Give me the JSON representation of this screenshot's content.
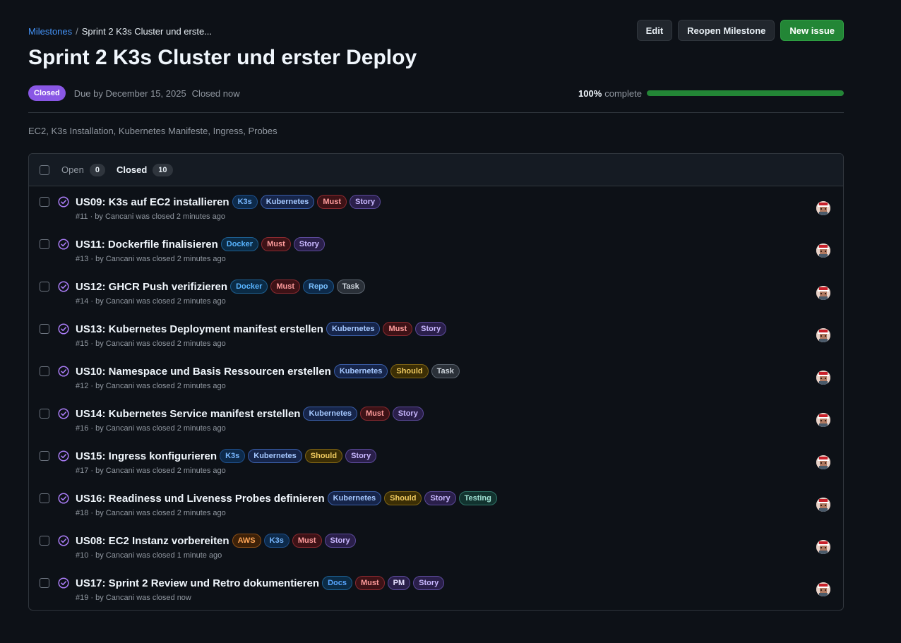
{
  "breadcrumb": {
    "root": "Milestones",
    "separator": "/",
    "current": "Sprint 2 K3s Cluster und erste..."
  },
  "actions": {
    "edit": "Edit",
    "reopen": "Reopen Milestone",
    "new_issue": "New issue"
  },
  "title": "Sprint 2 K3s Cluster und erster Deploy",
  "meta": {
    "state": "Closed",
    "due": "Due by December 15, 2025",
    "closed": "Closed now",
    "percent": "100%",
    "complete_label": "complete",
    "progress_fraction": 1.0
  },
  "description": "EC2, K3s Installation, Kubernetes Manifeste, Ingress, Probes",
  "tabs": {
    "open_label": "Open",
    "open_count": "0",
    "closed_label": "Closed",
    "closed_count": "10"
  },
  "label_colors": {
    "K3s": {
      "fg": "#79b8ff",
      "bg": "#0d2a4a",
      "border": "#1f4f8a"
    },
    "Kubernetes": {
      "fg": "#a5c8ff",
      "bg": "#16254a",
      "border": "#3a5ea8"
    },
    "Must": {
      "fg": "#ff9c9c",
      "bg": "#3d1216",
      "border": "#8a2a30"
    },
    "Story": {
      "fg": "#c9b8ff",
      "bg": "#2a1f4a",
      "border": "#5b4a9a"
    },
    "Docker": {
      "fg": "#58b4ff",
      "bg": "#0b2b45",
      "border": "#1d5e8f"
    },
    "Repo": {
      "fg": "#79c0ff",
      "bg": "#0d2a4a",
      "border": "#1f5a8f"
    },
    "Task": {
      "fg": "#d0d7de",
      "bg": "#2a3038",
      "border": "#5a636e"
    },
    "Should": {
      "fg": "#f2cc60",
      "bg": "#3b2e05",
      "border": "#806515"
    },
    "Testing": {
      "fg": "#9fe0d2",
      "bg": "#12332f",
      "border": "#2f7468"
    },
    "AWS": {
      "fg": "#ffa657",
      "bg": "#3d2108",
      "border": "#8a4e16"
    },
    "Docs": {
      "fg": "#58a6ff",
      "bg": "#0b2b45",
      "border": "#1d5e8f"
    },
    "PM": {
      "fg": "#e6e0ff",
      "bg": "#2a1f4a",
      "border": "#5b4a9a"
    }
  },
  "issues": [
    {
      "title": "US09: K3s auf EC2 installieren",
      "labels": [
        "K3s",
        "Kubernetes",
        "Must",
        "Story"
      ],
      "sub": "#11 · by Cancani was closed 2 minutes ago"
    },
    {
      "title": "US11: Dockerfile finalisieren",
      "labels": [
        "Docker",
        "Must",
        "Story"
      ],
      "sub": "#13 · by Cancani was closed 2 minutes ago"
    },
    {
      "title": "US12: GHCR Push verifizieren",
      "labels": [
        "Docker",
        "Must",
        "Repo",
        "Task"
      ],
      "sub": "#14 · by Cancani was closed 2 minutes ago"
    },
    {
      "title": "US13: Kubernetes Deployment manifest erstellen",
      "labels": [
        "Kubernetes",
        "Must",
        "Story"
      ],
      "sub": "#15 · by Cancani was closed 2 minutes ago"
    },
    {
      "title": "US10: Namespace und Basis Ressourcen erstellen",
      "labels": [
        "Kubernetes",
        "Should",
        "Task"
      ],
      "sub": "#12 · by Cancani was closed 2 minutes ago"
    },
    {
      "title": "US14: Kubernetes Service manifest erstellen",
      "labels": [
        "Kubernetes",
        "Must",
        "Story"
      ],
      "sub": "#16 · by Cancani was closed 2 minutes ago"
    },
    {
      "title": "US15: Ingress konfigurieren",
      "labels": [
        "K3s",
        "Kubernetes",
        "Should",
        "Story"
      ],
      "sub": "#17 · by Cancani was closed 2 minutes ago"
    },
    {
      "title": "US16: Readiness und Liveness Probes definieren",
      "labels": [
        "Kubernetes",
        "Should",
        "Story",
        "Testing"
      ],
      "sub": "#18 · by Cancani was closed 2 minutes ago"
    },
    {
      "title": "US08: EC2 Instanz vorbereiten",
      "labels": [
        "AWS",
        "K3s",
        "Must",
        "Story"
      ],
      "sub": "#10 · by Cancani was closed 1 minute ago"
    },
    {
      "title": "US17: Sprint 2 Review und Retro dokumentieren",
      "labels": [
        "Docs",
        "Must",
        "PM",
        "Story"
      ],
      "sub": "#19 · by Cancani was closed now"
    }
  ]
}
